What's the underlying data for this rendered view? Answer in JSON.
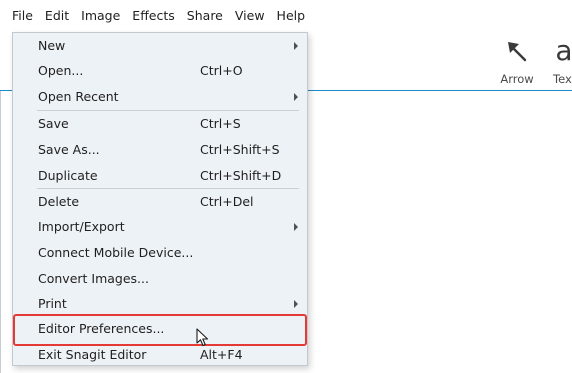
{
  "menubar": {
    "items": [
      {
        "label": "File"
      },
      {
        "label": "Edit"
      },
      {
        "label": "Image"
      },
      {
        "label": "Effects"
      },
      {
        "label": "Share"
      },
      {
        "label": "View"
      },
      {
        "label": "Help"
      }
    ]
  },
  "toolbar": {
    "tools": [
      {
        "label": "Arrow",
        "icon": "arrow-icon"
      },
      {
        "label": "Text",
        "icon": "text-icon",
        "glyph": "a"
      }
    ]
  },
  "file_menu": {
    "items": [
      {
        "label": "New",
        "shortcut": "",
        "submenu": true
      },
      {
        "label": "Open...",
        "shortcut": "Ctrl+O",
        "submenu": false
      },
      {
        "label": "Open Recent",
        "shortcut": "",
        "submenu": true
      },
      {
        "label": "Save",
        "shortcut": "Ctrl+S",
        "submenu": false
      },
      {
        "label": "Save As...",
        "shortcut": "Ctrl+Shift+S",
        "submenu": false
      },
      {
        "label": "Duplicate",
        "shortcut": "Ctrl+Shift+D",
        "submenu": false
      },
      {
        "label": "Delete",
        "shortcut": "Ctrl+Del",
        "submenu": false
      },
      {
        "label": "Import/Export",
        "shortcut": "",
        "submenu": true
      },
      {
        "label": "Connect Mobile Device...",
        "shortcut": "",
        "submenu": false
      },
      {
        "label": "Convert Images...",
        "shortcut": "",
        "submenu": false
      },
      {
        "label": "Print",
        "shortcut": "",
        "submenu": true
      },
      {
        "label": "Editor Preferences...",
        "shortcut": "",
        "submenu": false,
        "highlighted": true
      },
      {
        "label": "Exit Snagit Editor",
        "shortcut": "Alt+F4",
        "submenu": false
      }
    ]
  },
  "colors": {
    "menu_background": "#edf2f7",
    "highlight_border": "#e53935",
    "toolbar_divider": "#1e88c8"
  }
}
